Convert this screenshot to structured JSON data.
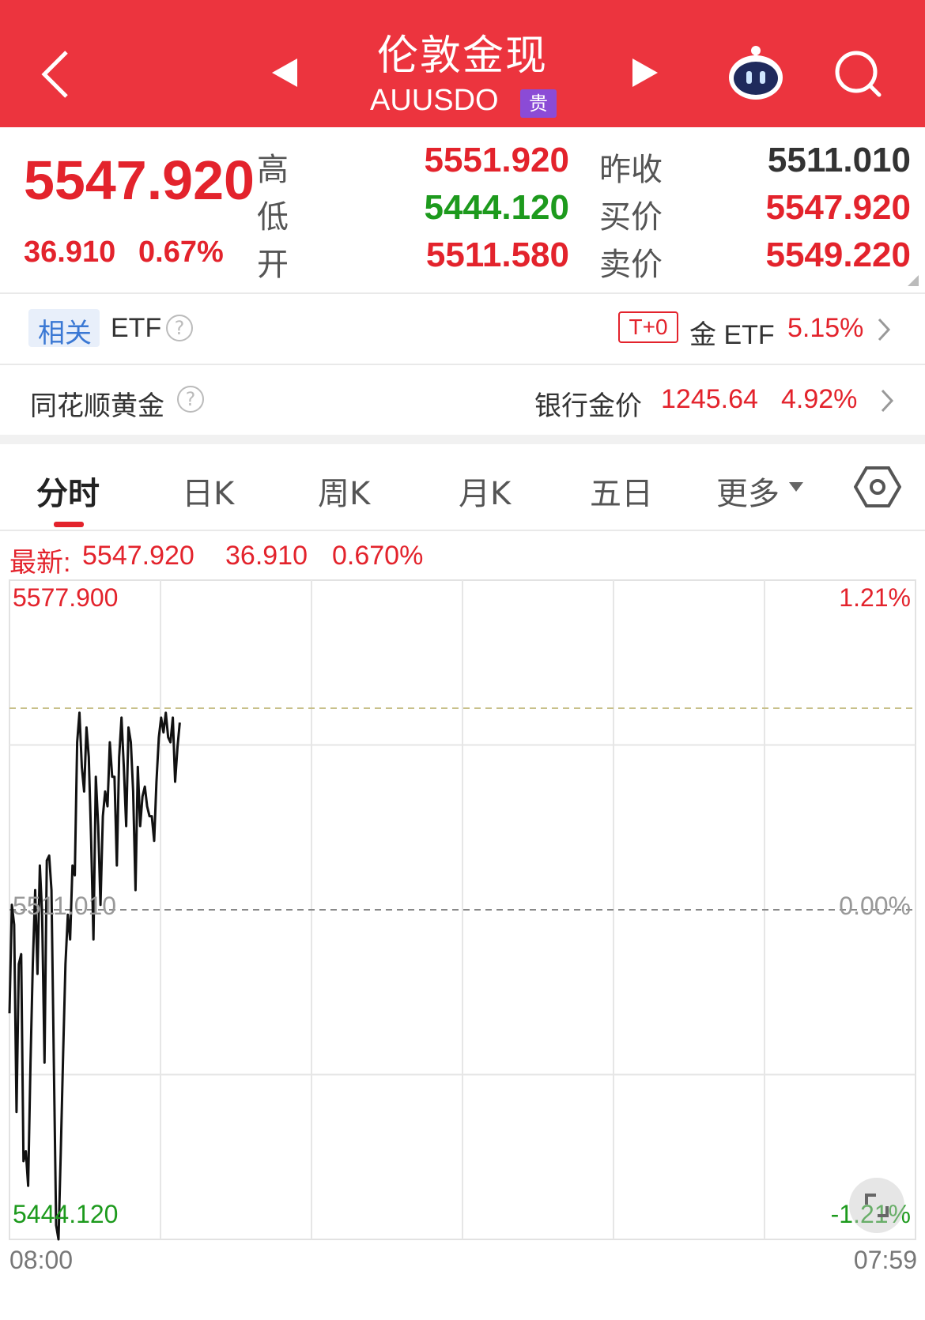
{
  "header": {
    "title": "伦敦金现",
    "code": "AUUSDO",
    "tag": "贵"
  },
  "quote": {
    "price": "5547.920",
    "change": "36.910",
    "change_pct": "0.67%",
    "rows": [
      {
        "label": "高",
        "value": "5551.920",
        "label2": "昨收",
        "value2": "5511.010"
      },
      {
        "label": "低",
        "value": "5444.120",
        "label2": "买价",
        "value2": "5547.920"
      },
      {
        "label": "开",
        "value": "5511.580",
        "label2": "卖价",
        "value2": "5549.220"
      }
    ]
  },
  "etf_row": {
    "related": "相关",
    "etf": "ETF",
    "t0_badge": "T+0",
    "gold_etf": "金 ETF",
    "gold_etf_pct": "5.15%"
  },
  "ths_row": {
    "label": "同花顺黄金",
    "bank_label": "银行金价",
    "bank_price": "1245.64",
    "bank_pct": "4.92%"
  },
  "tabs": [
    {
      "label": "分时",
      "active": true
    },
    {
      "label": "日K",
      "active": false
    },
    {
      "label": "周K",
      "active": false
    },
    {
      "label": "月K",
      "active": false
    },
    {
      "label": "五日",
      "active": false
    },
    {
      "label": "更多",
      "active": false
    }
  ],
  "latest_bar": {
    "label": "最新:",
    "price": "5547.920",
    "change": "36.910",
    "pct": "0.670%"
  },
  "chart_data": {
    "type": "line",
    "y_max_label": "5577.900",
    "y_mid_label": "5511.010",
    "y_min_label": "5444.120",
    "pct_max_label": "1.21%",
    "pct_mid_label": "0.00%",
    "pct_min_label": "-1.21%",
    "x_start": "08:00",
    "x_end": "07:59",
    "ylim": [
      5444.12,
      5577.9
    ],
    "prev_close": 5511.01,
    "high": 5551.92,
    "grid": true,
    "series": [
      {
        "values": [
          5490,
          5512,
          5508,
          5470,
          5500,
          5502,
          5460,
          5462,
          5455,
          5480,
          5500,
          5515,
          5498,
          5520,
          5510,
          5480,
          5521,
          5522,
          5515,
          5480,
          5447,
          5444.12,
          5462,
          5482,
          5500,
          5510,
          5505,
          5520,
          5518,
          5545,
          5551,
          5540,
          5535,
          5548,
          5542,
          5525,
          5505,
          5538,
          5528,
          5512,
          5530,
          5535,
          5532,
          5545,
          5538,
          5538,
          5520,
          5542,
          5550,
          5540,
          5528,
          5548,
          5545,
          5535,
          5515,
          5540,
          5528,
          5534,
          5536,
          5532,
          5530,
          5530,
          5525,
          5537,
          5546,
          5550,
          5547,
          5551,
          5546,
          5545,
          5550,
          5537,
          5544,
          5549
        ]
      }
    ]
  }
}
